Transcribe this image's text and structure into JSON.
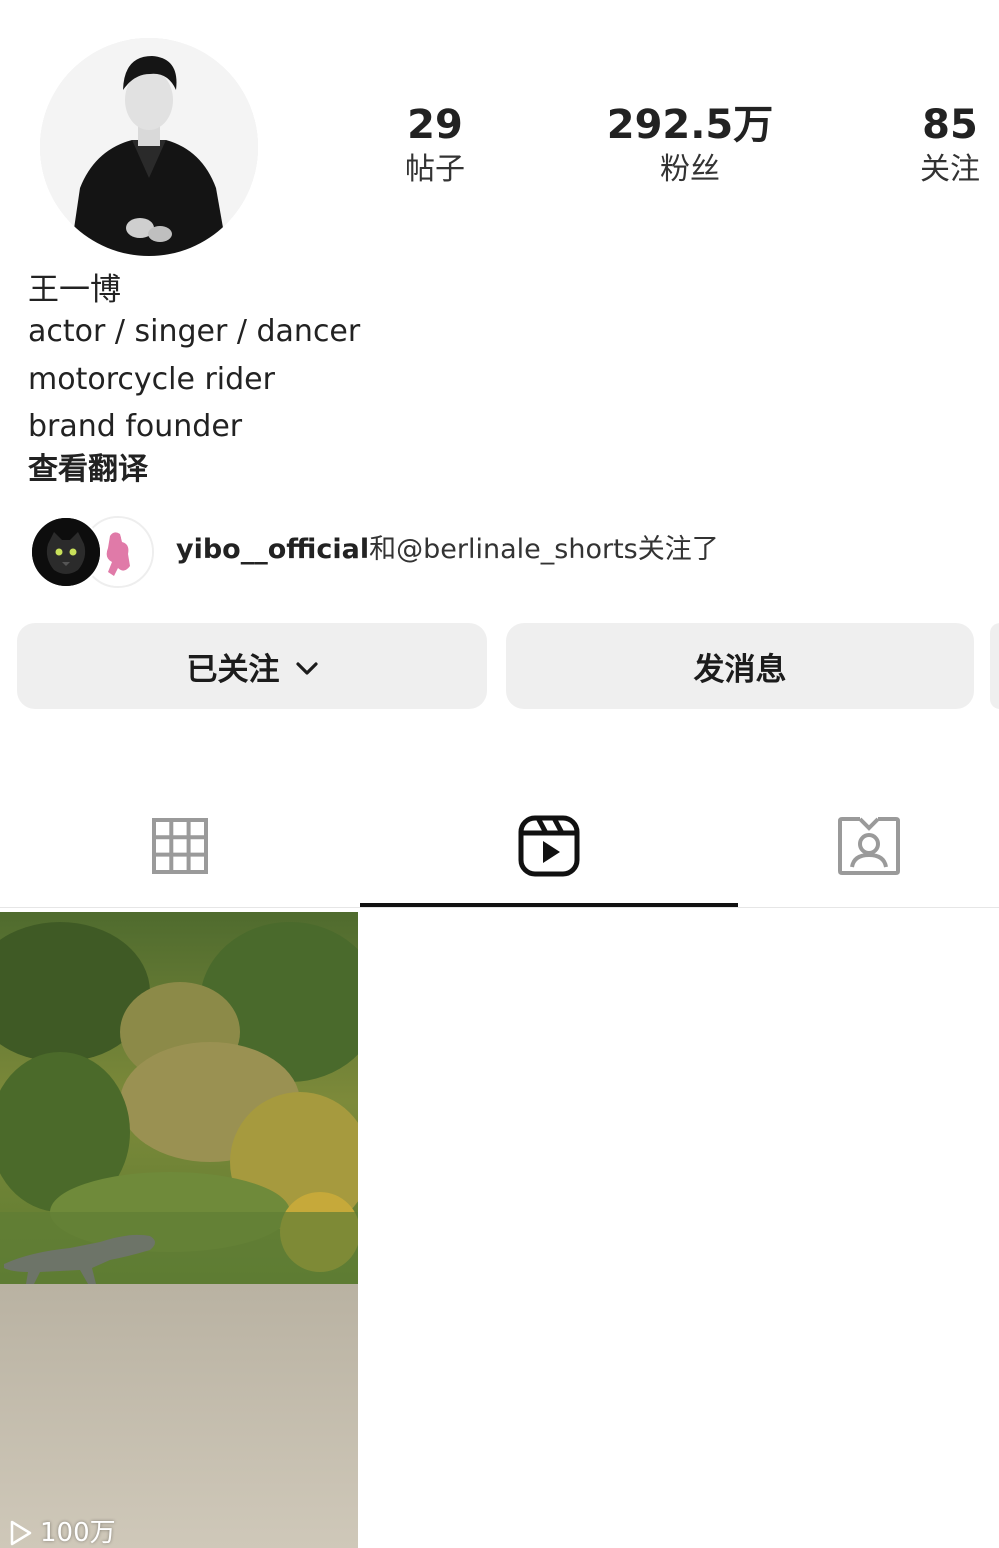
{
  "profile": {
    "name": "王一博",
    "bio": [
      "actor / singer / dancer",
      "motorcycle rider",
      "brand founder"
    ],
    "translate_label": "查看翻译",
    "stats": {
      "posts": {
        "value": "29",
        "label": "帖子"
      },
      "followers": {
        "value": "292.5万",
        "label": "粉丝"
      },
      "following": {
        "value": "85",
        "label": "关注"
      }
    }
  },
  "followed_by": {
    "user": "yibo__official",
    "rest": "和@berlinale_shorts关注了"
  },
  "actions": {
    "following_label": "已关注",
    "message_label": "发消息"
  },
  "tabs": {
    "items": [
      "grid-icon",
      "reels-icon",
      "tagged-icon"
    ],
    "active": "reels-icon"
  },
  "reels": [
    {
      "views": "100万"
    }
  ],
  "colors": {
    "button_bg": "#efefef",
    "text": "#1c1c1c",
    "inactive_icon": "#9a9a9a"
  }
}
